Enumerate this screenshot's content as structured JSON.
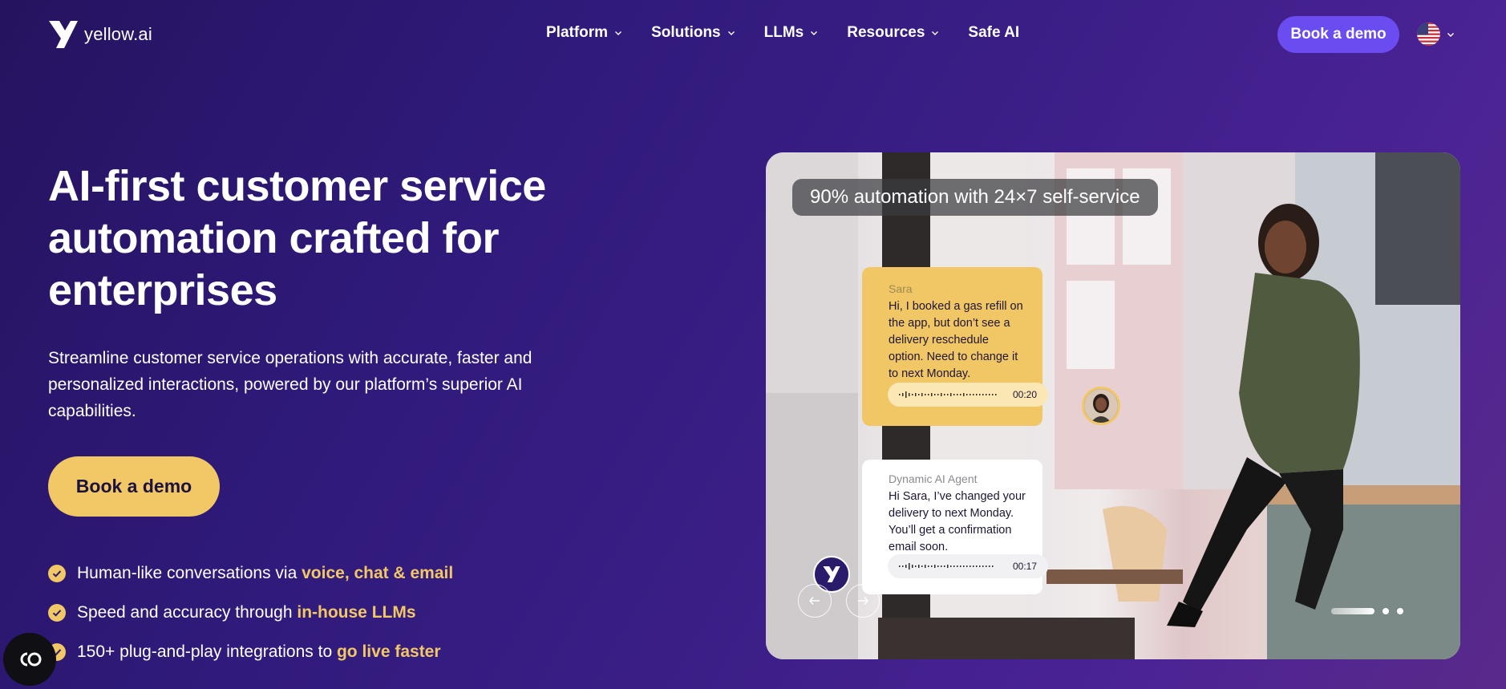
{
  "brand": {
    "name": "yellow.ai"
  },
  "nav": {
    "items": [
      {
        "label": "Platform",
        "has_dropdown": true
      },
      {
        "label": "Solutions",
        "has_dropdown": true
      },
      {
        "label": "LLMs",
        "has_dropdown": true
      },
      {
        "label": "Resources",
        "has_dropdown": true
      },
      {
        "label": "Safe AI",
        "has_dropdown": false
      }
    ],
    "cta_label": "Book a demo",
    "language_icon": "us-flag-icon"
  },
  "hero": {
    "title": "AI-first customer service automation crafted for enterprises",
    "subtitle": "Streamline customer service operations with accurate, faster and personalized interactions, powered by our platform’s superior AI capabilities.",
    "cta_label": "Book a demo",
    "features": [
      {
        "text": "Human-like conversations via ",
        "highlight": "voice, chat & email"
      },
      {
        "text": "Speed and accuracy through ",
        "highlight": "in-house LLMs"
      },
      {
        "text": "150+ plug-and-play integrations to ",
        "highlight": "go live faster"
      }
    ]
  },
  "visual": {
    "stat_pill": "90% automation with 24×7 self-service",
    "user_message": {
      "name": "Sara",
      "text": "Hi, I booked a gas refill on the app, but don’t see a delivery reschedule option. Need to change it to next Monday.",
      "duration": "00:20"
    },
    "agent_message": {
      "name": "Dynamic AI Agent",
      "text": "Hi Sara, I’ve changed your delivery to next Monday. You’ll get a confirmation email soon.",
      "duration": "00:17"
    },
    "carousel": {
      "slides": 3,
      "active_index": 0
    }
  },
  "colors": {
    "accent_yellow": "#f2c766",
    "accent_purple": "#6a4cf0",
    "bg_dark": "#26135f"
  }
}
